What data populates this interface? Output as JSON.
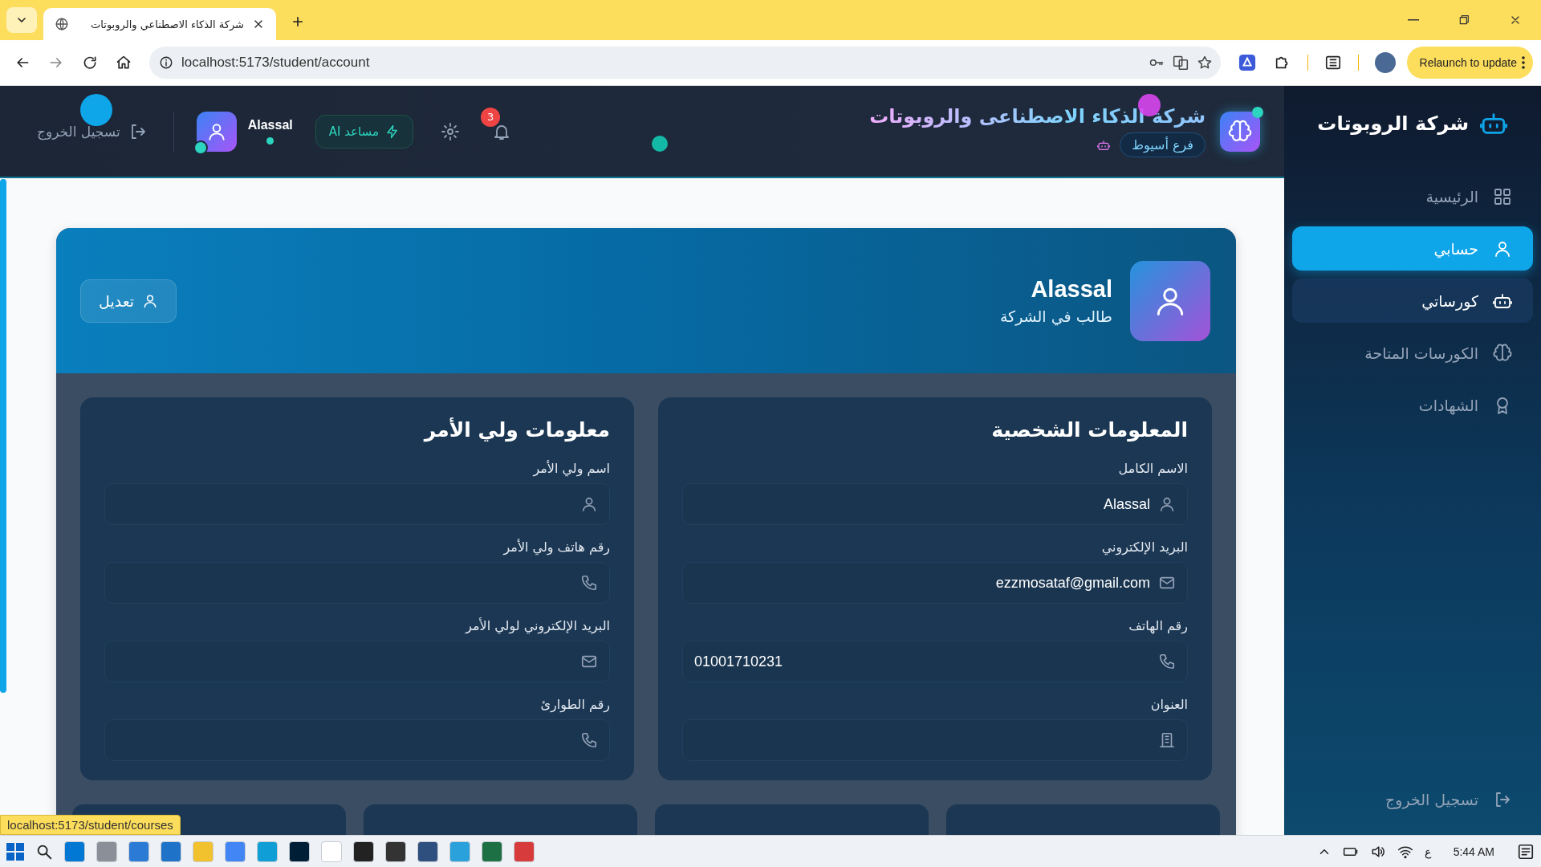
{
  "browser": {
    "tab_title": "شركة الذكاء الاصطناعي والروبوتات",
    "url": "localhost:5173/student/account",
    "update_button": "Relaunch to update"
  },
  "header": {
    "title": "شركة الذكاء الاصطناعى والروبوتات",
    "branch": "فرع أسيوط",
    "notification_count": "3",
    "ai_button": "مساعد AI",
    "user_name": "Alassal",
    "logout": "تسجيل الخروج"
  },
  "sidebar": {
    "title": "شركة الروبوتات",
    "items": [
      {
        "label": "الرئيسية",
        "kind": "dashboard",
        "selected": false,
        "hovered": false
      },
      {
        "label": "حسابي",
        "kind": "account",
        "selected": true,
        "hovered": false
      },
      {
        "label": "كورساتي",
        "kind": "mycourses",
        "selected": false,
        "hovered": true
      },
      {
        "label": "الكورسات المتاحة",
        "kind": "catalog",
        "selected": false,
        "hovered": false
      },
      {
        "label": "الشهادات",
        "kind": "certificates",
        "selected": false,
        "hovered": false
      }
    ],
    "logout": "تسجيل الخروج"
  },
  "profile": {
    "name": "Alassal",
    "role": "طالب في الشركة",
    "edit_button": "تعديل"
  },
  "sections": [
    {
      "title": "المعلومات الشخصية",
      "fields": [
        {
          "label": "الاسم الكامل",
          "value": "Alassal",
          "kind": "name"
        },
        {
          "label": "البريد الإلكتروني",
          "value": "ezzmosataf@gmail.com",
          "kind": "email"
        },
        {
          "label": "رقم الهاتف",
          "value": "01001710231",
          "kind": "phone"
        },
        {
          "label": "العنوان",
          "kind": "address"
        }
      ]
    },
    {
      "title": "معلومات ولي الأمر",
      "fields": [
        {
          "label": "اسم ولي الأمر",
          "kind": "name"
        },
        {
          "label": "رقم هاتف ولي الأمر",
          "kind": "phone"
        },
        {
          "label": "البريد الإلكتروني لولي الأمر",
          "kind": "email"
        },
        {
          "label": "رقم الطوارئ",
          "kind": "phone"
        }
      ]
    }
  ],
  "status_link": "localhost:5173/student/courses",
  "taskbar": {
    "language": "ع",
    "time": "5:44 AM"
  }
}
